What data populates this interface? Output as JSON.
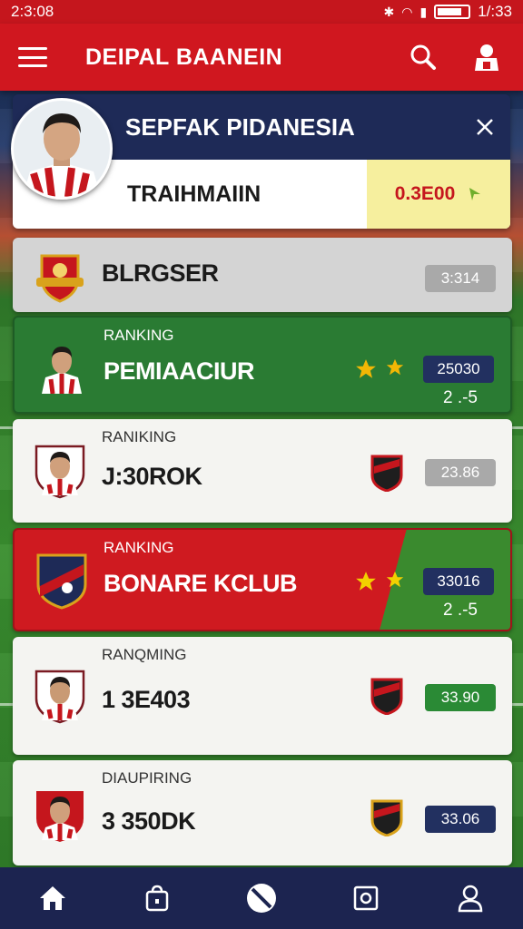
{
  "status_bar": {
    "time_left": "2:3:08",
    "time_right": "1/:33"
  },
  "app_bar": {
    "title": "DEIPAL BAANEIN"
  },
  "profile": {
    "name": "SEPFAK PIDANESIA",
    "subtitle": "TRAIHMAIIN",
    "score": "0.3E00"
  },
  "rows": [
    {
      "label": "",
      "title": "BLRGSER",
      "pill": "3:314",
      "sub": ""
    },
    {
      "label": "RANKING",
      "title": "PEMIAACIUR",
      "pill": "25030",
      "sub": "2 .-5"
    },
    {
      "label": "RANIKING",
      "title": "J:30ROK",
      "pill": "23.86",
      "sub": ""
    },
    {
      "label": "RANKING",
      "title": "BONARE KCLUB",
      "pill": "33016",
      "sub": "2 .-5"
    },
    {
      "label": "RANQMING",
      "title": "1 3E403",
      "pill": "33.90",
      "sub": ""
    },
    {
      "label": "DIAUPIRING",
      "title": "3 350DK",
      "pill": "33.06",
      "sub": ""
    }
  ],
  "colors": {
    "brand_red": "#d0171f",
    "navy": "#1e2a57",
    "green": "#2a7b33",
    "star": "#f2b705"
  },
  "icons": {
    "menu": "hamburger-icon",
    "search": "search-icon",
    "profile": "user-badge-icon",
    "nav": [
      "home-icon",
      "bag-icon",
      "ball-icon",
      "square-icon",
      "user-icon"
    ]
  }
}
